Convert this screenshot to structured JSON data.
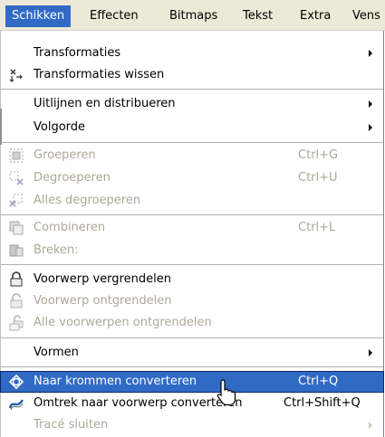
{
  "menubar": {
    "items": [
      {
        "label": "Schikken"
      },
      {
        "label": "Effecten"
      },
      {
        "label": "Bitmaps"
      },
      {
        "label": "Tekst"
      },
      {
        "label": "Extra"
      },
      {
        "label": "Vens"
      }
    ]
  },
  "menu": {
    "items": [
      {
        "label": "Transformaties",
        "shortcut": "",
        "icon": "none",
        "submenu": true,
        "enabled": true
      },
      {
        "label": "Transformaties wissen",
        "shortcut": "",
        "icon": "clear-transformations-icon",
        "submenu": false,
        "enabled": true
      },
      {
        "label": "Uitlijnen en distribueren",
        "shortcut": "",
        "icon": "none",
        "submenu": true,
        "enabled": true
      },
      {
        "label": "Volgorde",
        "shortcut": "",
        "icon": "none",
        "submenu": true,
        "enabled": true
      },
      {
        "label": "Groeperen",
        "shortcut": "Ctrl+G",
        "icon": "group-icon",
        "submenu": false,
        "enabled": false
      },
      {
        "label": "Degroeperen",
        "shortcut": "Ctrl+U",
        "icon": "ungroup-icon",
        "submenu": false,
        "enabled": false
      },
      {
        "label": "Alles degroeperen",
        "shortcut": "",
        "icon": "ungroup-all-icon",
        "submenu": false,
        "enabled": false
      },
      {
        "label": "Combineren",
        "shortcut": "Ctrl+L",
        "icon": "combine-icon",
        "submenu": false,
        "enabled": false
      },
      {
        "label": "Breken:",
        "shortcut": "",
        "icon": "break-apart-icon",
        "submenu": false,
        "enabled": false
      },
      {
        "label": "Voorwerp vergrendelen",
        "shortcut": "",
        "icon": "lock-icon",
        "submenu": false,
        "enabled": true
      },
      {
        "label": "Voorwerp ontgrendelen",
        "shortcut": "",
        "icon": "unlock-icon",
        "submenu": false,
        "enabled": false
      },
      {
        "label": "Alle voorwerpen ontgrendelen",
        "shortcut": "",
        "icon": "unlock-all-icon",
        "submenu": false,
        "enabled": false
      },
      {
        "label": "Vormen",
        "shortcut": "",
        "icon": "none",
        "submenu": true,
        "enabled": true
      },
      {
        "label": "Naar krommen converteren",
        "shortcut": "Ctrl+Q",
        "icon": "convert-to-curves-icon",
        "submenu": false,
        "enabled": true,
        "highlighted": true
      },
      {
        "label": "Omtrek naar voorwerp converteren",
        "shortcut": "Ctrl+Shift+Q",
        "icon": "outline-to-object-icon",
        "submenu": false,
        "enabled": true
      },
      {
        "label": "Tracé sluiten",
        "shortcut": "",
        "icon": "none",
        "submenu": true,
        "enabled": false
      }
    ]
  },
  "colors": {
    "menubar_bg": "#ece9d8",
    "highlight": "#316ac5",
    "disabled_text": "#aca899"
  }
}
